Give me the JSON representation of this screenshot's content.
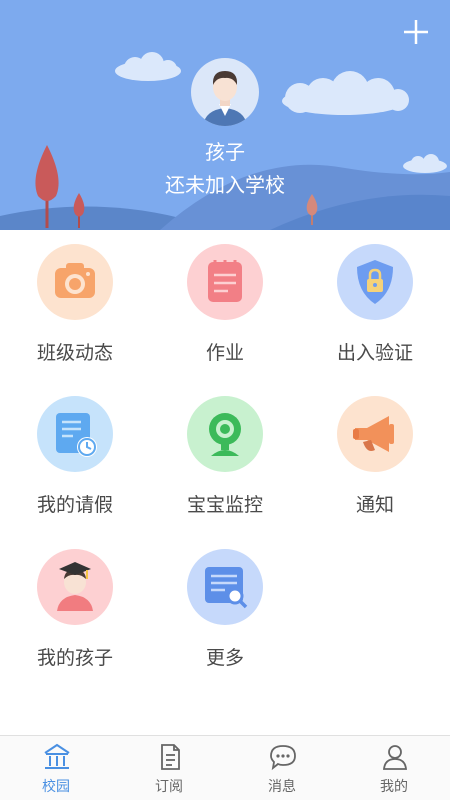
{
  "header": {
    "child_name": "孩子",
    "school_status": "还未加入学校",
    "add_icon": "plus-icon",
    "avatar_icon": "boy-avatar-icon",
    "bg_color": "#7daaee"
  },
  "grid": {
    "items": [
      {
        "label": "班级动态",
        "icon": "camera-icon",
        "color": "#fde3cf"
      },
      {
        "label": "作业",
        "icon": "notebook-icon",
        "color": "#fdd0d2"
      },
      {
        "label": "出入验证",
        "icon": "shield-lock-icon",
        "color": "#c6d9fb"
      },
      {
        "label": "我的请假",
        "icon": "leave-document-icon",
        "color": "#c6e3fb"
      },
      {
        "label": "宝宝监控",
        "icon": "webcam-icon",
        "color": "#c8f1cf"
      },
      {
        "label": "通知",
        "icon": "megaphone-icon",
        "color": "#fde3cf"
      },
      {
        "label": "我的孩子",
        "icon": "graduate-icon",
        "color": "#fdd0d2"
      },
      {
        "label": "更多",
        "icon": "document-search-icon",
        "color": "#c6d9fb"
      }
    ]
  },
  "tabbar": {
    "active_color": "#4a90e2",
    "tabs": [
      {
        "label": "校园",
        "icon": "school-icon",
        "active": true
      },
      {
        "label": "订阅",
        "icon": "subscription-icon",
        "active": false
      },
      {
        "label": "消息",
        "icon": "message-icon",
        "active": false
      },
      {
        "label": "我的",
        "icon": "profile-icon",
        "active": false
      }
    ]
  }
}
